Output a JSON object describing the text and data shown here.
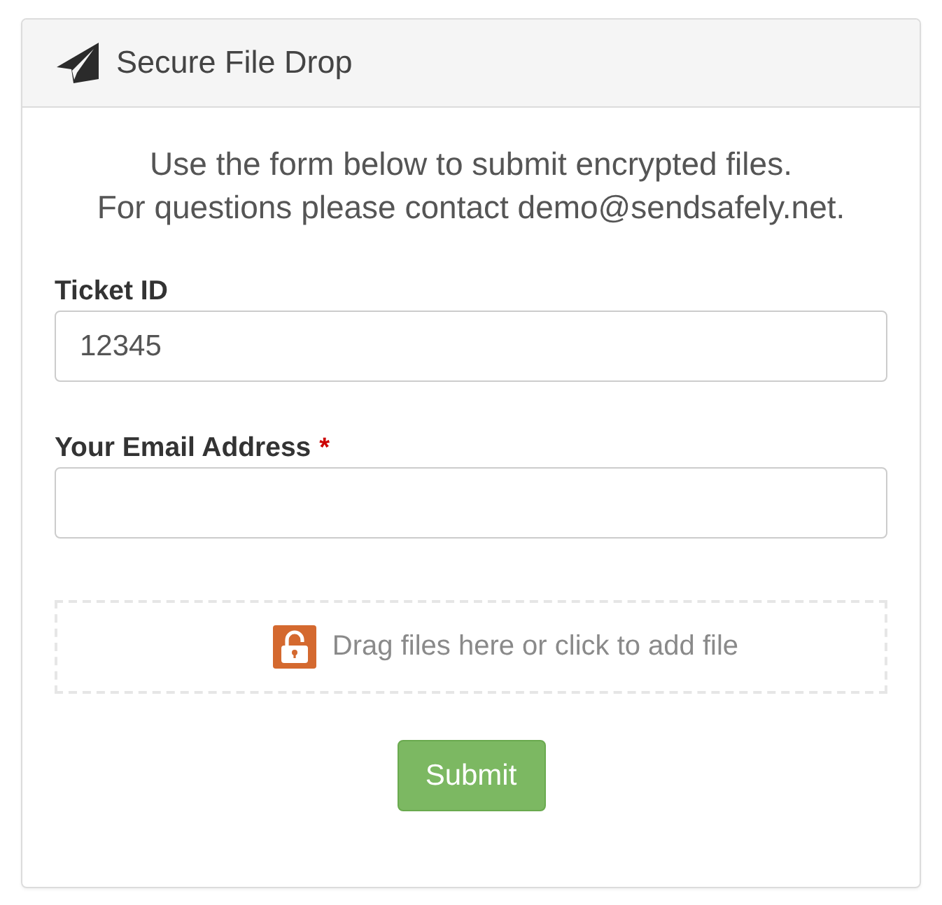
{
  "panel": {
    "title": "Secure File Drop"
  },
  "intro": [
    "Use the form below to submit encrypted files.",
    "For questions please contact demo@sendsafely.net."
  ],
  "form": {
    "required_mark": "*",
    "fields": [
      {
        "label": "Ticket ID",
        "value": "12345",
        "required": false
      },
      {
        "label": "Your Email Address",
        "required": true
      }
    ]
  },
  "dropzone": {
    "text": "Drag files here or click to add file"
  },
  "buttons": [
    {
      "label": "Submit"
    }
  ]
}
